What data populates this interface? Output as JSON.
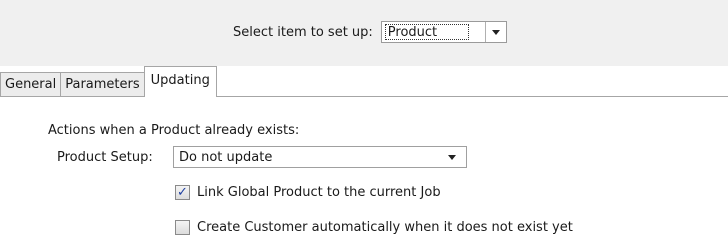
{
  "header": {
    "select_label": "Select item to set up:",
    "selected_item": "Product"
  },
  "tabs": [
    {
      "label": "General",
      "active": false
    },
    {
      "label": "Parameters",
      "active": false
    },
    {
      "label": "Updating",
      "active": true
    }
  ],
  "updating": {
    "heading": "Actions when a Product already exists:",
    "product_setup_label": "Product Setup:",
    "product_setup_value": "Do not update",
    "options": [
      {
        "label": "Link Global Product to the current Job",
        "checked": true
      },
      {
        "label": "Create Customer automatically when it does not exist yet",
        "checked": false
      }
    ]
  },
  "icons": {
    "dropdown": "chevron-down-icon",
    "check": "checkmark-icon"
  }
}
